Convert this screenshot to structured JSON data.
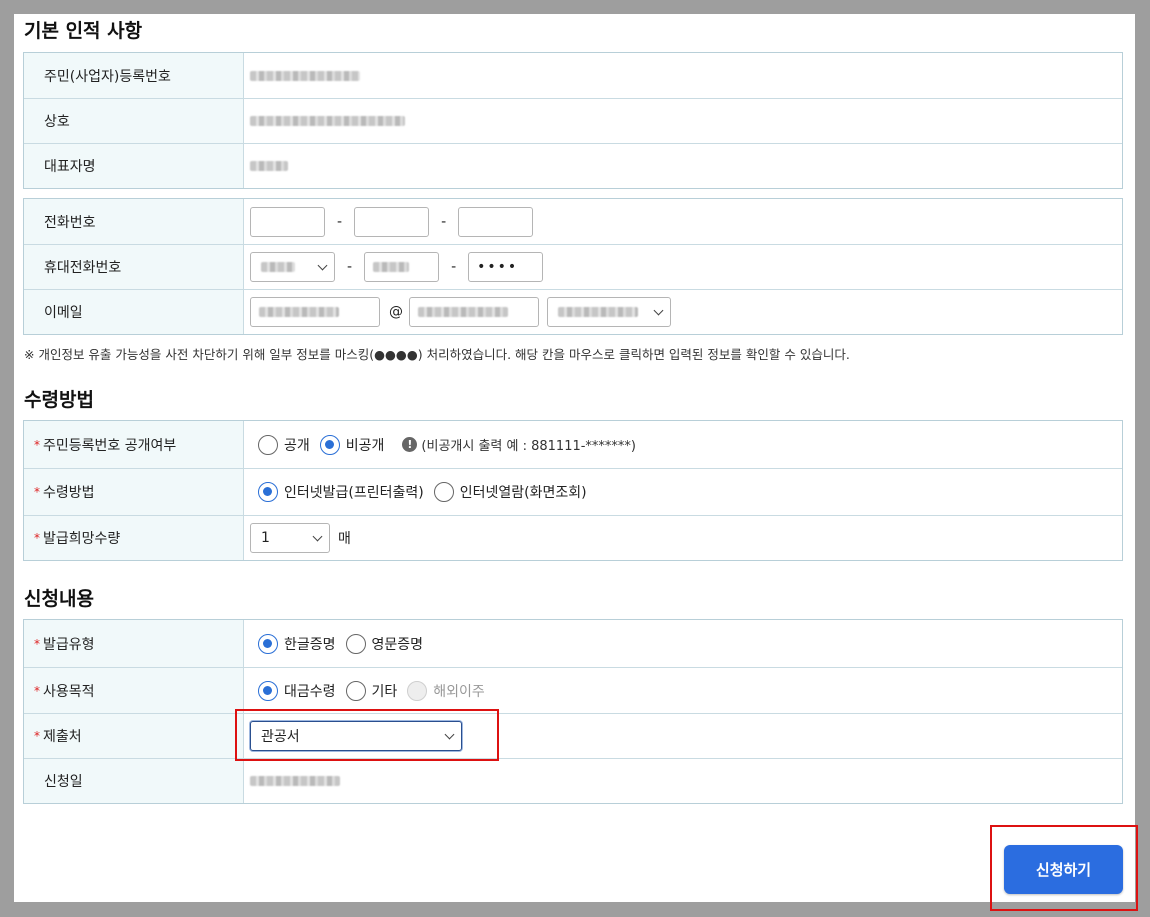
{
  "sections": {
    "basic": "기본 인적 사항",
    "receive": "수령방법",
    "request": "신청내용"
  },
  "basic": {
    "rrn_label": "주민(사업자)등록번호",
    "company_label": "상호",
    "ceo_label": "대표자명"
  },
  "contact": {
    "phone_label": "전화번호",
    "mobile_label": "휴대전화번호",
    "email_label": "이메일",
    "dash": "-",
    "at": "@",
    "mobile_last": "••••"
  },
  "note": "※ 개인정보 유출 가능성을 사전 차단하기 위해 일부 정보를 마스킹(●●●●) 처리하였습니다. 해당 칸을 마우스로 클릭하면 입력된 정보를 확인할 수 있습니다.",
  "receive": {
    "disclose_label": "주민등록번호 공개여부",
    "disclose_options": [
      "공개",
      "비공개"
    ],
    "disclose_selected": 1,
    "info_icon": "!",
    "disclose_hint": "(비공개시 출력 예 : 881111-*******)",
    "method_label": "수령방법",
    "method_options": [
      "인터넷발급(프린터출력)",
      "인터넷열람(화면조회)"
    ],
    "method_selected": 0,
    "qty_label": "발급희망수량",
    "qty_value": "1",
    "qty_unit": "매"
  },
  "request": {
    "type_label": "발급유형",
    "type_options": [
      "한글증명",
      "영문증명"
    ],
    "type_selected": 0,
    "purpose_label": "사용목적",
    "purpose_options": [
      "대금수령",
      "기타",
      "해외이주"
    ],
    "purpose_selected": 0,
    "submit_to_label": "제출처",
    "submit_to_value": "관공서",
    "date_label": "신청일"
  },
  "submit_label": "신청하기",
  "colors": {
    "accent": "#2b6de0",
    "highlight": "#d11111",
    "header_bg": "#f1f9fa"
  }
}
